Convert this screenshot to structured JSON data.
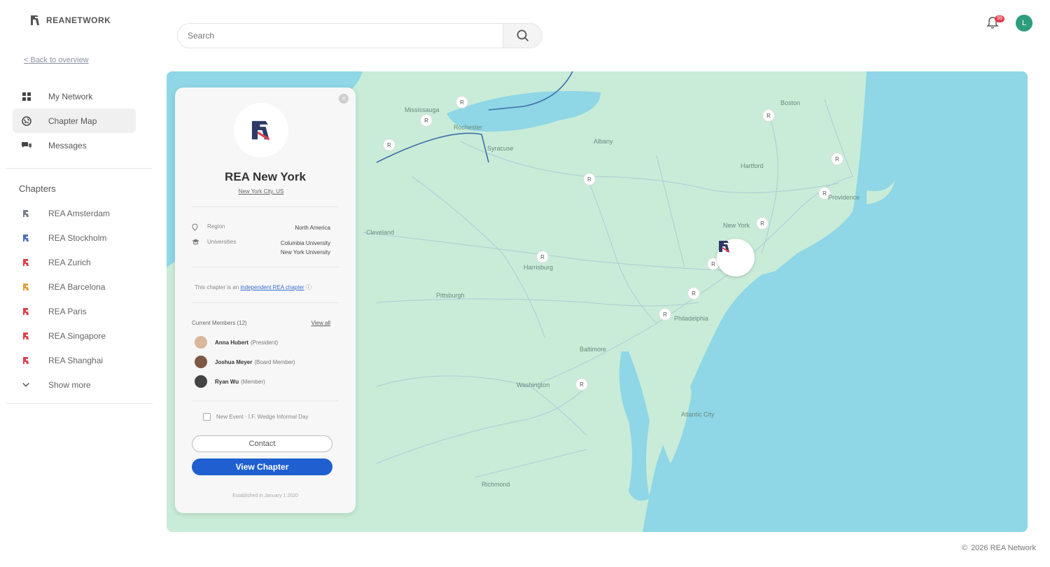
{
  "brand": {
    "name": "REANETWORK"
  },
  "sidebar": {
    "back_link": "< Back to overview",
    "nav": [
      {
        "label": "My Network",
        "icon": "network-icon"
      },
      {
        "label": "Chapter Map",
        "icon": "globe-icon",
        "active": true
      },
      {
        "label": "Messages",
        "icon": "chat-icon"
      }
    ],
    "chapters_title": "Chapters",
    "chapters": [
      {
        "label": "REA Amsterdam",
        "color": "#7a7f8a"
      },
      {
        "label": "REA Stockholm",
        "color": "#4a6fb5"
      },
      {
        "label": "REA Zurich",
        "color": "#e0414f"
      },
      {
        "label": "REA Barcelona",
        "color": "#e0a03a"
      },
      {
        "label": "REA Paris",
        "color": "#e0414f"
      },
      {
        "label": "REA Singapore",
        "color": "#e0414f"
      },
      {
        "label": "REA Shanghai",
        "color": "#e0414f"
      }
    ],
    "show_more": "Show more"
  },
  "header": {
    "search_placeholder": "Search",
    "notification_count": "99",
    "user_initial": "L"
  },
  "map": {
    "places": [
      "Mississauga",
      "Rochester",
      "Syracuse",
      "Albany",
      "Boston",
      "Providence",
      "Hartford",
      "New York",
      "Cleveland",
      "Pittsburgh",
      "Harrisburg",
      "Philadelphia",
      "Washington",
      "Baltimore",
      "Richmond",
      "Atlantic City"
    ]
  },
  "card": {
    "title": "REA New York",
    "subtitle": "New York City, US",
    "region_label": "Region",
    "region_value": "North America",
    "universities_label": "Universities",
    "universities_value_1": "Columbia University",
    "universities_value_2": "New York University",
    "linked_prefix": "This chapter is an",
    "linked_link": "independent REA chapter",
    "members_title": "Current Members (12)",
    "view_all": "View all",
    "members": [
      {
        "name": "Anna Hubert",
        "role": "(President)"
      },
      {
        "name": "Joshua Meyer",
        "role": "(Board Member)"
      },
      {
        "name": "Ryan Wu",
        "role": "(Member)"
      }
    ],
    "newsletter": "New Event · I.F. Wedge Informal Day",
    "contact_label": "Contact",
    "view_label": "View Chapter",
    "footer": "Established in January 1 2020"
  },
  "footer": {
    "text": "2026 REA Network"
  }
}
